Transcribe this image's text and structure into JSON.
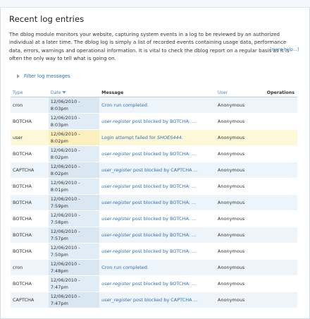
{
  "page": {
    "title": "Recent log entries",
    "description": "The dblog module monitors your website, capturing system events in a log to be reviewed by an authorized individual at a later time. The dblog log is simply a list of recorded events containing usage data, performance data, errors, warnings and operational information. It is vital to check the dblog report on a regular basis as it is often the only way to tell what is going on.",
    "more_help": "[more help...]",
    "filter_label": "Filter log messages"
  },
  "table": {
    "headers": {
      "type": "Type",
      "date": "Date",
      "message": "Message",
      "user": "User",
      "operations": "Operations"
    },
    "rows": [
      {
        "type": "cron",
        "date_line1": "12/06/2010 -",
        "date_line2": "8:03pm",
        "message_link": "Cron run completed.",
        "message_italic": "",
        "message_after": "",
        "user": "Anonymous",
        "style": "alt"
      },
      {
        "type": "BOTCHA",
        "date_line1": "12/06/2010 -",
        "date_line2": "8:03pm",
        "message_link": "",
        "message_italic": "user-register",
        "message_after": " post blocked by BOTCHA: ...",
        "user": "Anonymous",
        "style": "plain"
      },
      {
        "type": "user",
        "date_line1": "12/06/2010 -",
        "date_line2": "8:02pm",
        "message_link": "Login attempt failed for ",
        "message_italic": "SHOES444",
        "message_after": ".",
        "user": "Anonymous",
        "style": "warn"
      },
      {
        "type": "BOTCHA",
        "date_line1": "12/06/2010 -",
        "date_line2": "8:02pm",
        "message_link": "",
        "message_italic": "user-register",
        "message_after": " post blocked by BOTCHA: ...",
        "user": "Anonymous",
        "style": "plain"
      },
      {
        "type": "CAPTCHA",
        "date_line1": "12/06/2010 -",
        "date_line2": "8:02pm",
        "message_link": "",
        "message_italic": "user_register",
        "message_after": " post blocked by CAPTCHA ...",
        "user": "Anonymous",
        "style": "alt"
      },
      {
        "type": "BOTCHA",
        "date_line1": "12/06/2010 -",
        "date_line2": "8:01pm",
        "message_link": "",
        "message_italic": "user-register",
        "message_after": " post blocked by BOTCHA: ...",
        "user": "Anonymous",
        "style": "plain"
      },
      {
        "type": "BOTCHA",
        "date_line1": "12/06/2010 -",
        "date_line2": "7:59pm",
        "message_link": "",
        "message_italic": "user-register",
        "message_after": " post blocked by BOTCHA: ...",
        "user": "Anonymous",
        "style": "alt"
      },
      {
        "type": "BOTCHA",
        "date_line1": "12/06/2010 -",
        "date_line2": "7:58pm",
        "message_link": "",
        "message_italic": "user-register",
        "message_after": " post blocked by BOTCHA: ...",
        "user": "Anonymous",
        "style": "plain"
      },
      {
        "type": "BOTCHA",
        "date_line1": "12/06/2010 -",
        "date_line2": "7:57pm",
        "message_link": "",
        "message_italic": "user-register",
        "message_after": " post blocked by BOTCHA: ...",
        "user": "Anonymous",
        "style": "alt"
      },
      {
        "type": "BOTCHA",
        "date_line1": "12/06/2010 -",
        "date_line2": "7:50pm",
        "message_link": "",
        "message_italic": "user-register",
        "message_after": " post blocked by BOTCHA: ...",
        "user": "Anonymous",
        "style": "plain"
      },
      {
        "type": "cron",
        "date_line1": "12/06/2010 -",
        "date_line2": "7:48pm",
        "message_link": "Cron run completed.",
        "message_italic": "",
        "message_after": "",
        "user": "Anonymous",
        "style": "alt"
      },
      {
        "type": "BOTCHA",
        "date_line1": "12/06/2010 -",
        "date_line2": "7:47pm",
        "message_link": "",
        "message_italic": "user-register",
        "message_after": " post blocked by BOTCHA: ...",
        "user": "Anonymous",
        "style": "plain"
      },
      {
        "type": "CAPTCHA",
        "date_line1": "12/06/2010 -",
        "date_line2": "7:47pm",
        "message_link": "",
        "message_italic": "user_register",
        "message_after": " post blocked by CAPTCHA ...",
        "user": "Anonymous",
        "style": "alt"
      }
    ]
  },
  "colors": {
    "link": "#2b6fb6",
    "row_alt": "#edf5fa",
    "row_warn": "#fdf8d7",
    "date_col": "#e1edf6"
  }
}
